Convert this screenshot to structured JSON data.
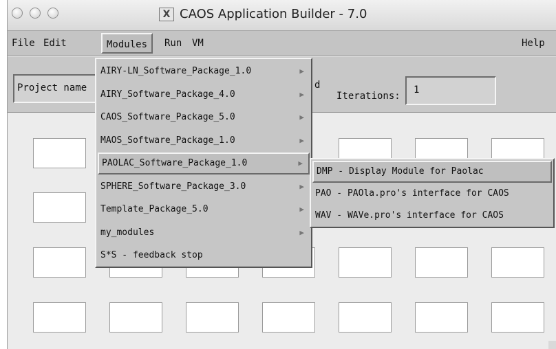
{
  "window": {
    "title": "CAOS Application Builder - 7.0",
    "title_icon": "x11-icon"
  },
  "menubar": {
    "items": [
      "File",
      "Edit",
      "Modules",
      "Run",
      "VM"
    ],
    "help": "Help",
    "active": "Modules"
  },
  "toolbar": {
    "project_name_value": "Project name",
    "partial_label": "d",
    "iterations_label": "Iterations:",
    "iterations_value": "1"
  },
  "modules_menu": {
    "items": [
      "AIRY-LN_Software_Package_1.0",
      "AIRY_Software_Package_4.0",
      "CAOS_Software_Package_5.0",
      "MAOS_Software_Package_1.0",
      "PAOLAC_Software_Package_1.0",
      "SPHERE_Software_Package_3.0",
      "Template_Package_5.0",
      "my_modules",
      "S*S - feedback stop"
    ],
    "active_index": 4
  },
  "submenu": {
    "items": [
      "DMP - Display Module for Paolac",
      "PAO - PAOla.pro's interface for CAOS",
      "WAV - WAVe.pro's interface for CAOS"
    ],
    "active_index": 0
  }
}
